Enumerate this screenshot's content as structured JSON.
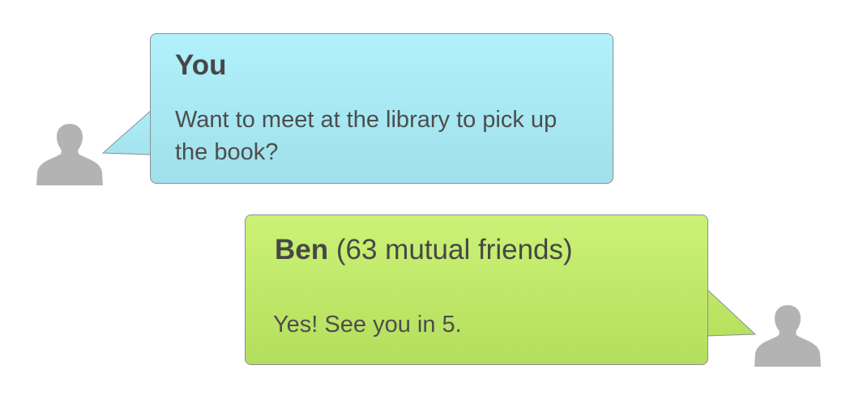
{
  "conversation": {
    "messages": [
      {
        "sender": "You",
        "sender_meta": "",
        "text": "Want to meet at the library to pick up the book?",
        "side": "left",
        "bubble_color": "#aeeef8"
      },
      {
        "sender": "Ben",
        "sender_meta": "(63 mutual friends)",
        "text": "Yes! See you in 5.",
        "side": "right",
        "bubble_color": "#c4ec6e"
      }
    ]
  },
  "icons": {
    "left_avatar": "user-silhouette-icon",
    "right_avatar": "user-silhouette-icon"
  },
  "colors": {
    "avatar": "#b3b3b3",
    "bubble_border": "#8a8f93",
    "text": "#4a4a4a"
  }
}
